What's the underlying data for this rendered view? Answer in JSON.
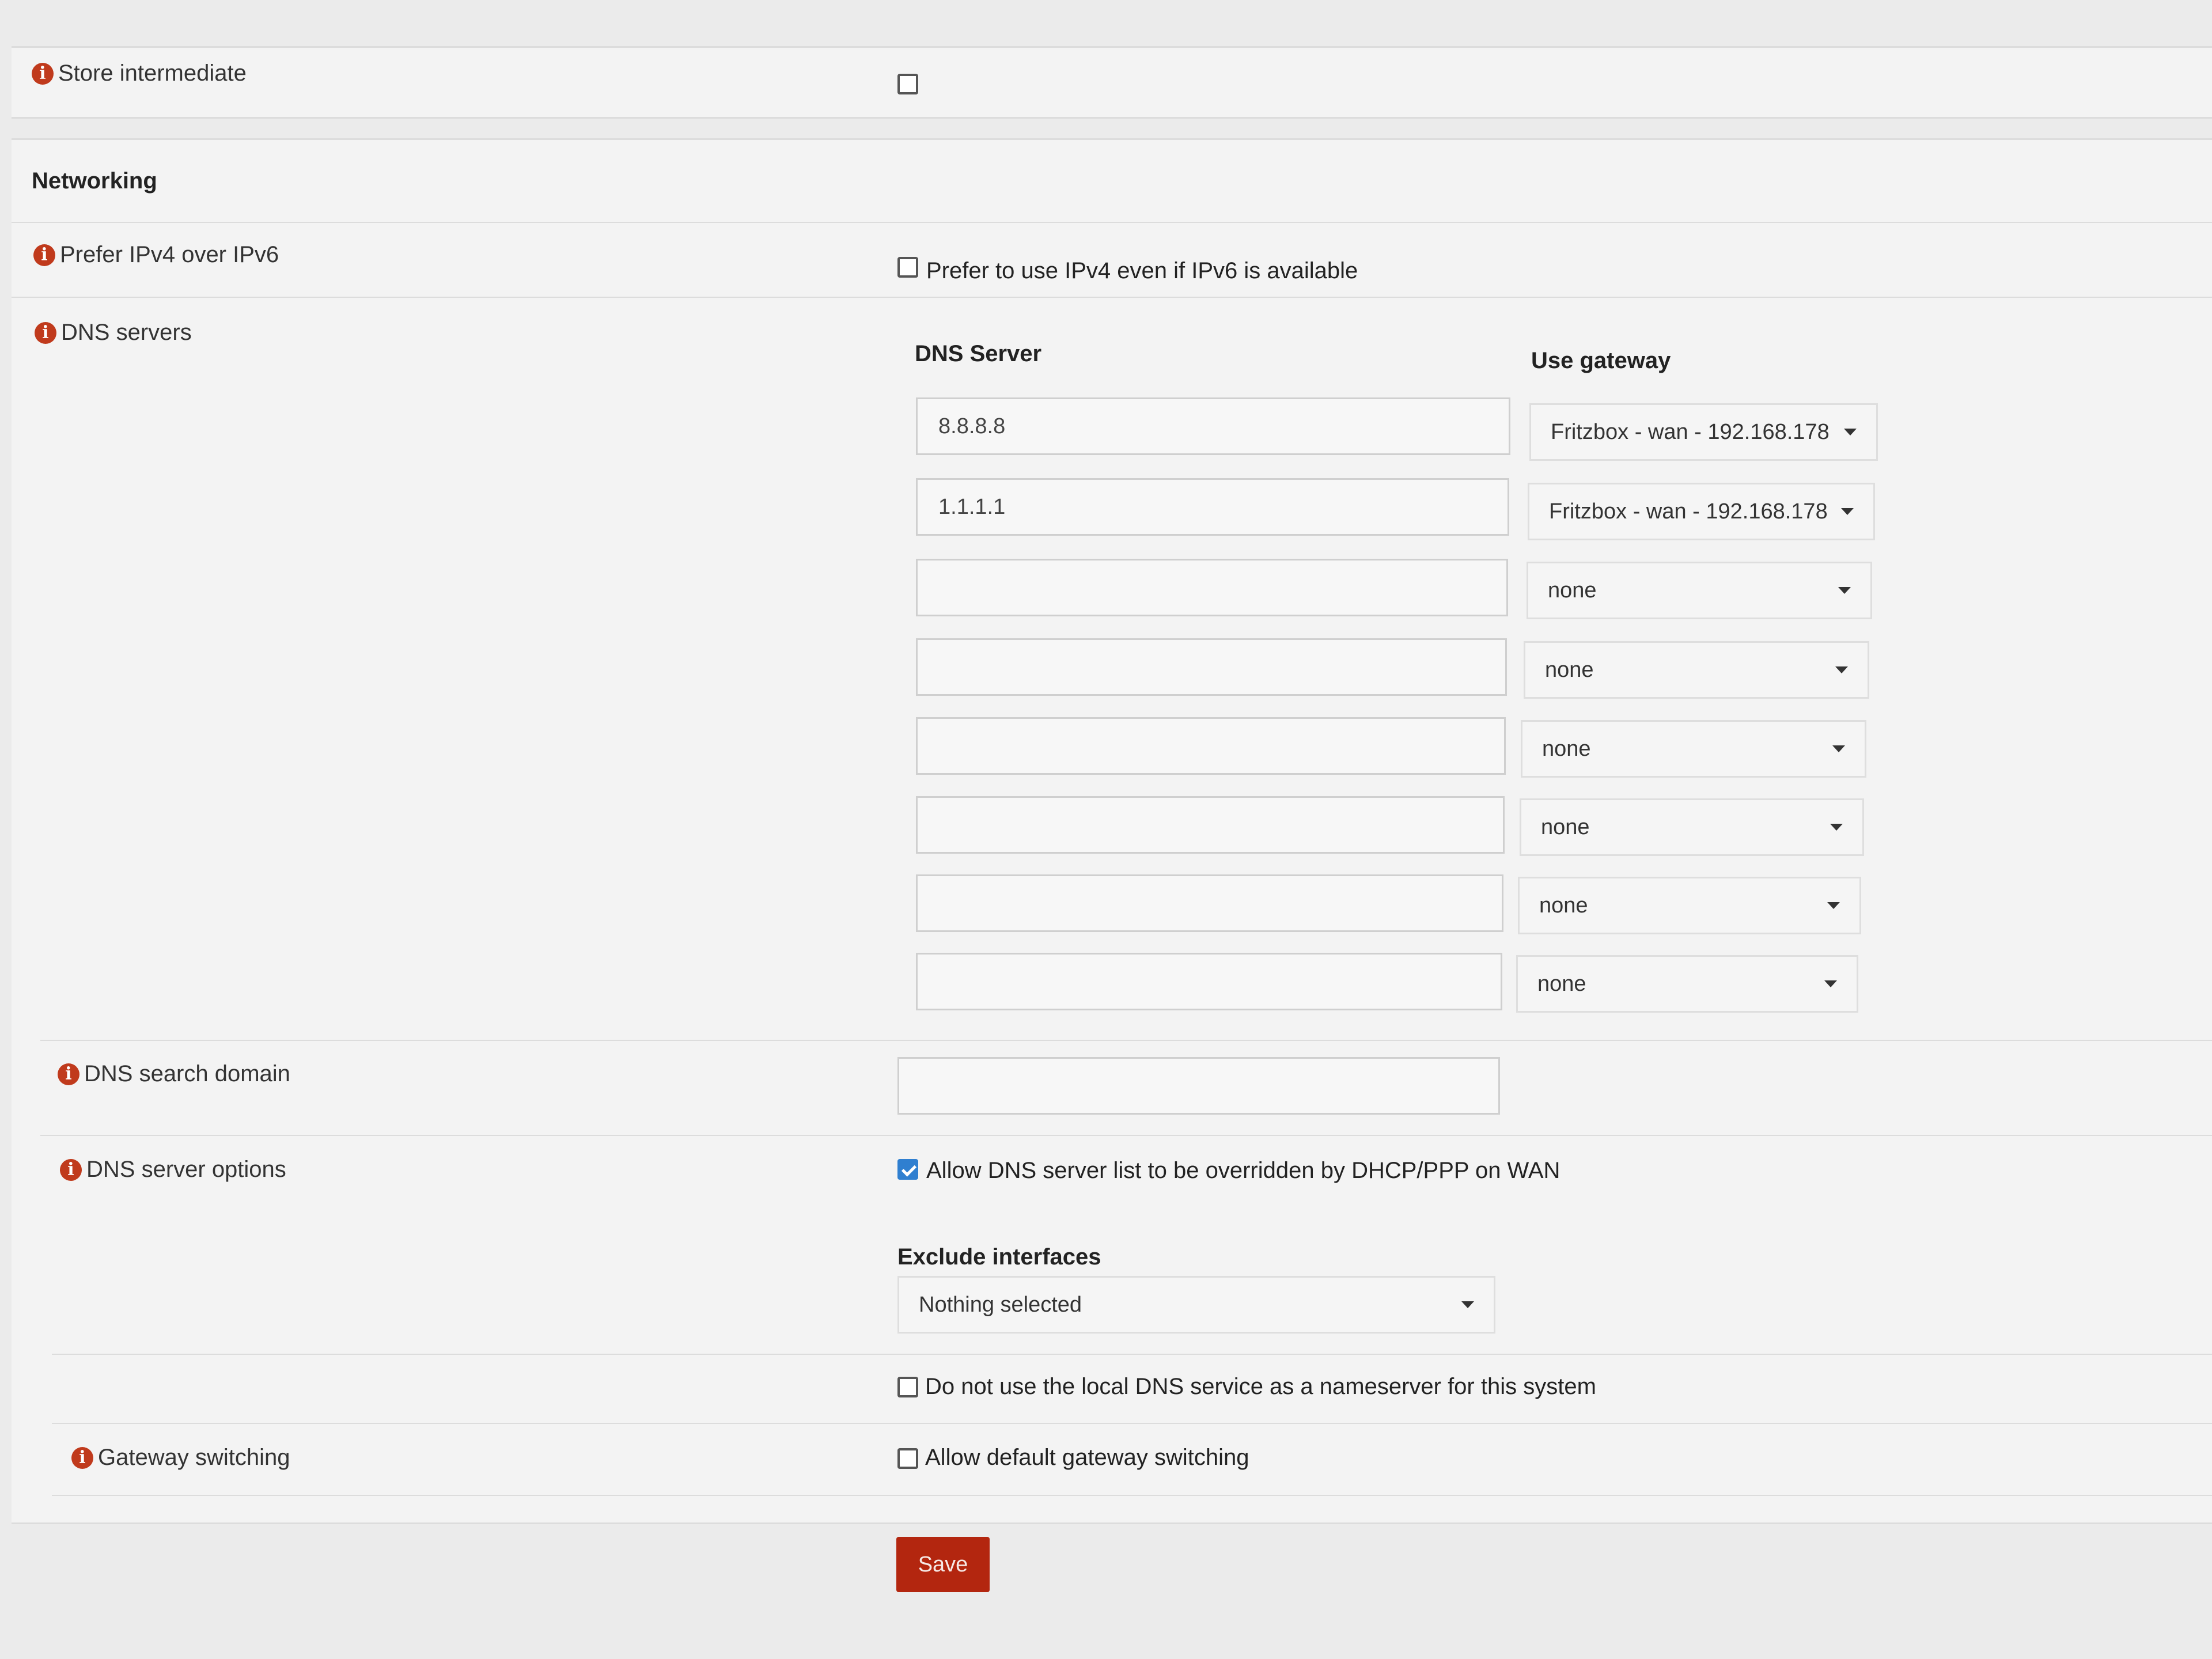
{
  "store_intermediate": {
    "label": "Store intermediate",
    "checked": false
  },
  "networking": {
    "section_title": "Networking",
    "prefer_ipv4": {
      "label": "Prefer IPv4 over IPv6",
      "checkbox_text": "Prefer to use IPv4 even if IPv6 is available",
      "checked": false
    },
    "dns_servers": {
      "label": "DNS servers",
      "col_server": "DNS Server",
      "col_gateway": "Use gateway",
      "rows": [
        {
          "server": "8.8.8.8",
          "gateway": "Fritzbox - wan - 192.168.178"
        },
        {
          "server": "1.1.1.1",
          "gateway": "Fritzbox - wan - 192.168.178"
        },
        {
          "server": "",
          "gateway": "none"
        },
        {
          "server": "",
          "gateway": "none"
        },
        {
          "server": "",
          "gateway": "none"
        },
        {
          "server": "",
          "gateway": "none"
        },
        {
          "server": "",
          "gateway": "none"
        },
        {
          "server": "",
          "gateway": "none"
        }
      ]
    },
    "dns_search_domain": {
      "label": "DNS search domain",
      "value": ""
    },
    "dns_server_options": {
      "label": "DNS server options",
      "allow_override_text": "Allow DNS server list to be overridden by DHCP/PPP on WAN",
      "allow_override_checked": true,
      "exclude_label": "Exclude interfaces",
      "exclude_value": "Nothing selected",
      "no_local_dns_text": "Do not use the local DNS service as a nameserver for this system",
      "no_local_dns_checked": false
    },
    "gateway_switching": {
      "label": "Gateway switching",
      "checkbox_text": "Allow default gateway switching",
      "checked": false
    }
  },
  "save_label": "Save",
  "colors": {
    "accent_info": "#c03a1c",
    "save_button": "#b3260f",
    "checkbox_checked": "#2f7fd0"
  }
}
